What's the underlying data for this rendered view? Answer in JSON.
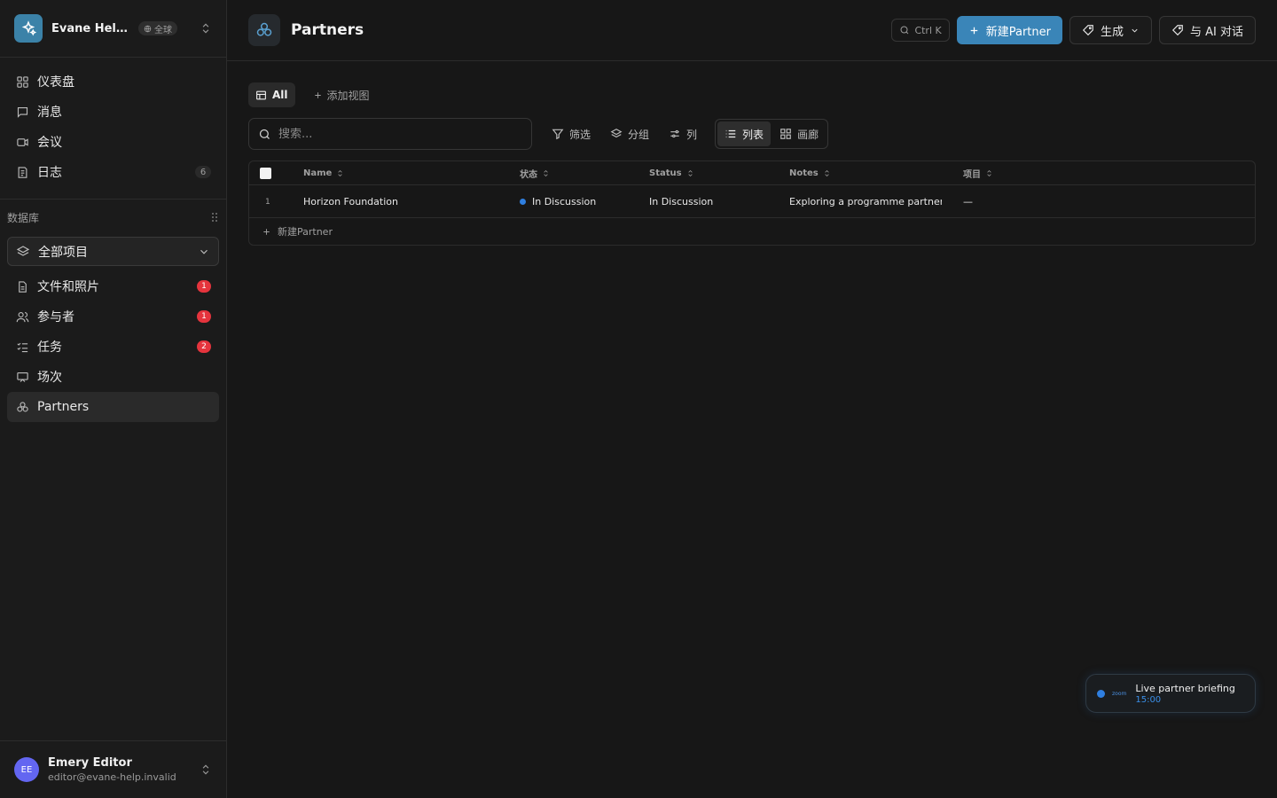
{
  "workspace": {
    "name": "Evane Help ...",
    "badge": "全球"
  },
  "nav": [
    {
      "label": "仪表盘",
      "icon": "grid-icon"
    },
    {
      "label": "消息",
      "icon": "message-icon"
    },
    {
      "label": "会议",
      "icon": "video-icon"
    },
    {
      "label": "日志",
      "icon": "log-icon",
      "count": "6"
    }
  ],
  "database": {
    "heading": "数据库",
    "selected": "全部项目",
    "items": [
      {
        "label": "文件和照片",
        "badge": "1"
      },
      {
        "label": "参与者",
        "badge": "1"
      },
      {
        "label": "任务",
        "badge": "2"
      },
      {
        "label": "场次"
      },
      {
        "label": "Partners",
        "active": true
      }
    ]
  },
  "user": {
    "initials": "EE",
    "name": "Emery Editor",
    "email": "editor@evane-help.invalid"
  },
  "header": {
    "title": "Partners",
    "shortcut": "Ctrl K",
    "new_button": "新建Partner",
    "generate_button": "生成",
    "ai_button": "与 AI 对话"
  },
  "views": {
    "active": "All",
    "add": "添加视图"
  },
  "toolbar": {
    "search_placeholder": "搜索...",
    "filter": "筛选",
    "group": "分组",
    "columns": "列",
    "list": "列表",
    "gallery": "画廊"
  },
  "table": {
    "columns": [
      "Name",
      "状态",
      "Status",
      "Notes",
      "项目"
    ],
    "rows": [
      {
        "num": "1",
        "name": "Horizon Foundation",
        "state": "In Discussion",
        "status": "In Discussion",
        "notes": "Exploring a programme partnership",
        "project": "—"
      }
    ],
    "new_row": "新建Partner"
  },
  "toast": {
    "title": "Live partner briefing",
    "time": "15:00",
    "logo": "zoom"
  },
  "colors": {
    "accent": "#3a85b8",
    "status_dot": "#2f7fe0",
    "badge_red": "#e5343d"
  }
}
